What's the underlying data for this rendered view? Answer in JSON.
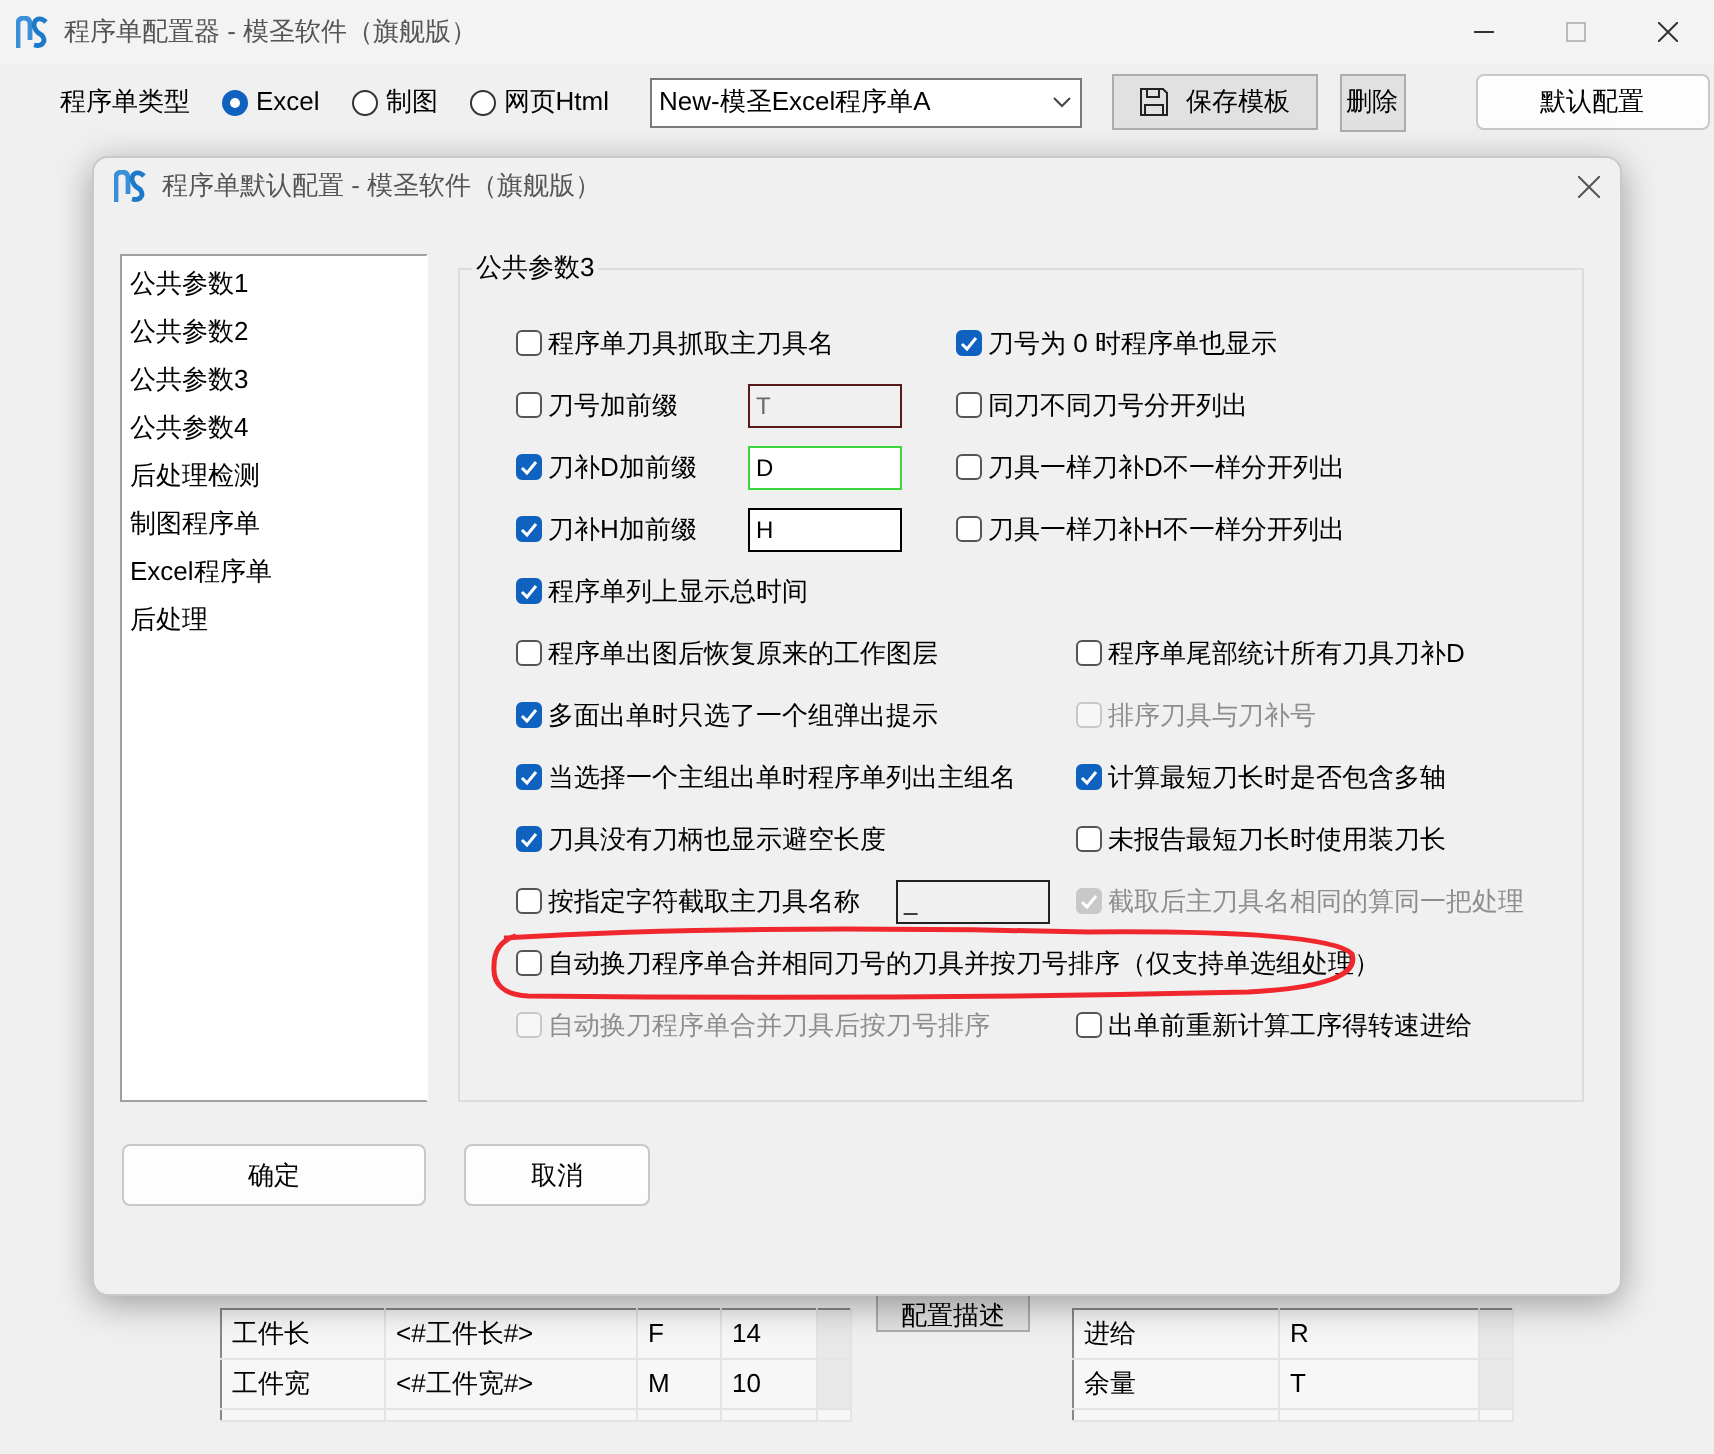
{
  "window": {
    "title": "程序单配置器 - 模圣软件（旗舰版）"
  },
  "toolbar": {
    "type_label": "程序单类型",
    "types": [
      {
        "label": "Excel",
        "selected": true
      },
      {
        "label": "制图",
        "selected": false
      },
      {
        "label": "网页Html",
        "selected": false
      }
    ],
    "template": "New-模圣Excel程序单A",
    "save_button": "保存模板",
    "delete_button": "删除",
    "default_button": "默认配置"
  },
  "background": {
    "describe_button": "配置描述",
    "left_table": {
      "rows": [
        [
          "工件长",
          "<#工件长#>",
          "F",
          "14"
        ],
        [
          "工件宽",
          "<#工件宽#>",
          "M",
          "10"
        ]
      ]
    },
    "right_table": {
      "rows": [
        [
          "进给",
          "R"
        ],
        [
          "余量",
          "T"
        ]
      ]
    }
  },
  "dialog": {
    "title": "程序单默认配置 - 模圣软件（旗舰版）",
    "categories": [
      "公共参数1",
      "公共参数2",
      "公共参数3",
      "公共参数4",
      "后处理检测",
      "制图程序单",
      "Excel程序单",
      "后处理"
    ],
    "group_title": "公共参数3",
    "sections": [
      {
        "rows": [
          [
            {
              "label": "程序单刀具抓取主刀具名",
              "checked": false,
              "disabled": false,
              "circled": false
            },
            {
              "label": "刀号为 0 时程序单也显示",
              "checked": true,
              "disabled": false,
              "circled": false
            }
          ],
          [
            {
              "label": "刀号加前缀",
              "checked": false,
              "disabled": false,
              "circled": false,
              "field": {
                "value": "T",
                "disabled": true,
                "focused": false,
                "readonly": false
              }
            },
            {
              "label": "同刀不同刀号分开列出",
              "checked": false,
              "disabled": false,
              "circled": false
            }
          ],
          [
            {
              "label": "刀补D加前缀",
              "checked": true,
              "disabled": false,
              "circled": false,
              "field": {
                "value": "D",
                "disabled": false,
                "focused": true,
                "readonly": false
              }
            },
            {
              "label": "刀具一样刀补D不一样分开列出",
              "checked": false,
              "disabled": false,
              "circled": false
            }
          ],
          [
            {
              "label": "刀补H加前缀",
              "checked": true,
              "disabled": false,
              "circled": false,
              "field": {
                "value": "H",
                "disabled": false,
                "focused": false,
                "readonly": false
              }
            },
            {
              "label": "刀具一样刀补H不一样分开列出",
              "checked": false,
              "disabled": false,
              "circled": false
            }
          ],
          [
            {
              "label": "程序单列上显示总时间",
              "checked": true,
              "disabled": false,
              "circled": false
            }
          ]
        ]
      },
      {
        "rows": [
          [
            {
              "label": "程序单出图后恢复原来的工作图层",
              "checked": false,
              "disabled": false,
              "circled": false
            },
            {
              "label": "程序单尾部统计所有刀具刀补D",
              "checked": false,
              "disabled": false,
              "circled": false
            }
          ],
          [
            {
              "label": "多面出单时只选了一个组弹出提示",
              "checked": true,
              "disabled": false,
              "circled": false
            },
            {
              "label": "排序刀具与刀补号",
              "checked": false,
              "disabled": true,
              "circled": false
            }
          ],
          [
            {
              "label": "当选择一个主组出单时程序单列出主组名",
              "checked": true,
              "disabled": false,
              "circled": false
            },
            {
              "label": "计算最短刀长时是否包含多轴",
              "checked": true,
              "disabled": false,
              "circled": false
            }
          ],
          [
            {
              "label": "刀具没有刀柄也显示避空长度",
              "checked": true,
              "disabled": false,
              "circled": false
            },
            {
              "label": "未报告最短刀长时使用装刀长",
              "checked": false,
              "disabled": false,
              "circled": false
            }
          ],
          [
            {
              "label": "按指定字符截取主刀具名称",
              "checked": false,
              "disabled": false,
              "circled": false,
              "field": {
                "value": "_",
                "disabled": false,
                "focused": false,
                "readonly": true
              }
            },
            {
              "label": "截取后主刀具名相同的算同一把处理",
              "checked": true,
              "disabled": true,
              "circled": false
            }
          ],
          [
            {
              "label": "自动换刀程序单合并相同刀号的刀具并按刀号排序（仅支持单选组处理）",
              "checked": false,
              "disabled": false,
              "circled": true
            }
          ],
          [
            {
              "label": "自动换刀程序单合并刀具后按刀号排序",
              "checked": false,
              "disabled": true,
              "circled": false
            },
            {
              "label": "出单前重新计算工序得转速进给",
              "checked": false,
              "disabled": false,
              "circled": false
            }
          ]
        ]
      }
    ],
    "ok_button": "确定",
    "cancel_button": "取消"
  }
}
